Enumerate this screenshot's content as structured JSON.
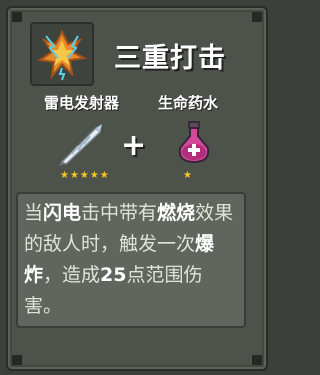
{
  "skill": {
    "title": "三重打击",
    "icon": "orange-lightning-crest-icon"
  },
  "recipe": {
    "item1": {
      "name": "雷电发射器",
      "icon": "white-feather-dart-icon",
      "stars": "★★★★★",
      "star_count": 5
    },
    "plus": "+",
    "item2": {
      "name": "生命药水",
      "icon": "pink-potion-flask-icon",
      "stars": "★",
      "star_count": 1
    }
  },
  "description": {
    "p1": "当",
    "k1": "闪电",
    "p2": "击中带有",
    "k2": "燃烧",
    "p3": "效果的敌人时，触发一次",
    "k3": "爆炸",
    "p4": "，造成",
    "k4": "25",
    "p5": "点范围伤害。"
  },
  "colors": {
    "background": "#3c3f3a",
    "card": "#4d524b",
    "description_panel": "#60665d",
    "star": "#f6c623",
    "text": "#ffffff"
  }
}
